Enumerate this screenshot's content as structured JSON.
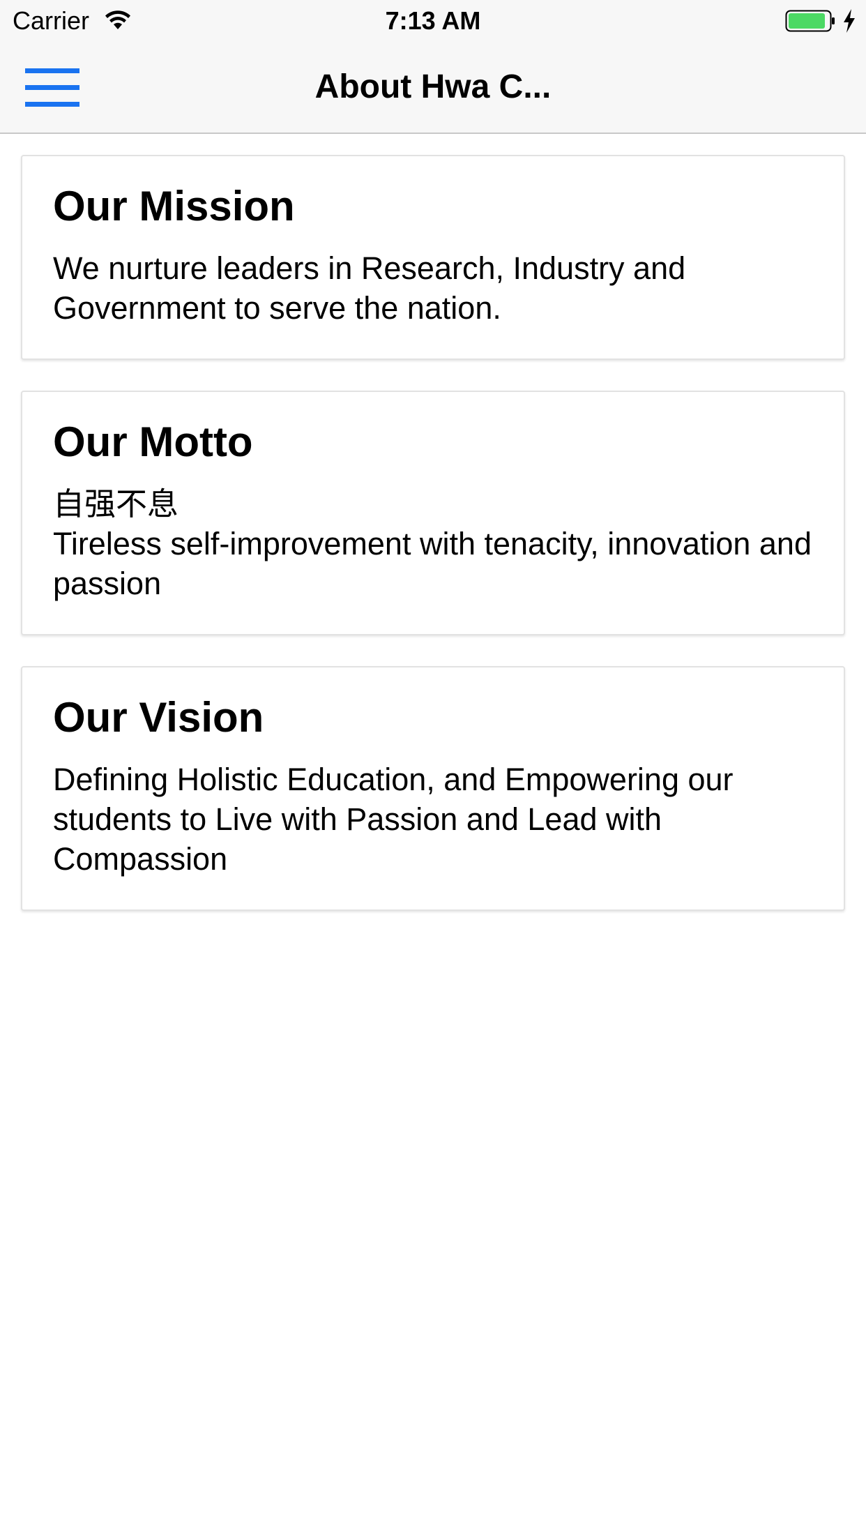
{
  "status_bar": {
    "carrier": "Carrier",
    "time": "7:13 AM"
  },
  "nav": {
    "title": "About Hwa C...",
    "menu_icon": "hamburger-menu-icon",
    "accent_color": "#1a73f0"
  },
  "cards": [
    {
      "title": "Our Mission",
      "body": "We nurture leaders in Research, Industry and Government to serve the nation."
    },
    {
      "title": "Our Motto",
      "body_chinese": "自强不息",
      "body": "Tireless self-improvement with tenacity, innovation and passion"
    },
    {
      "title": "Our Vision",
      "body": "Defining Holistic Education, and Empowering our students to Live with Passion and Lead with Compassion"
    }
  ]
}
